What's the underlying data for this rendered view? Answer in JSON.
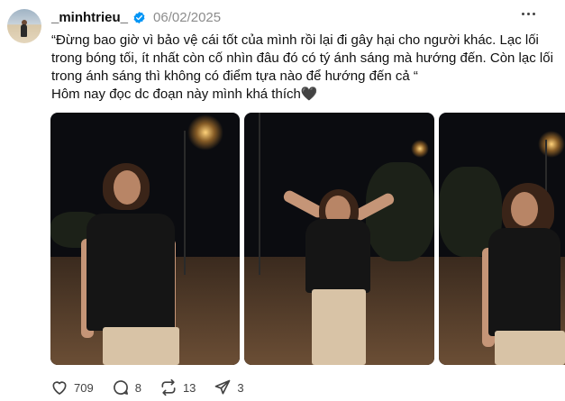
{
  "post": {
    "username": "_minhtrieu_",
    "date": "06/02/2025",
    "caption_line1": "“Đừng bao giờ vì bảo vệ cái tốt của mình rồi lại đi gây hại cho người khác. Lạc lối trong bóng tối, ít nhất còn cố nhìn đâu đó có tý ánh sáng mà hướng đến. Còn lạc lối trong ánh sáng thì không có điểm tựa nào để hướng đến cả “",
    "caption_line2": "Hôm nay đọc dc đoạn này mình khá thích🖤"
  },
  "actions": {
    "likes": "709",
    "comments": "8",
    "reposts": "13",
    "shares": "3"
  },
  "icons": [
    "verified-badge-icon",
    "more-dots-icon",
    "heart-icon",
    "comment-icon",
    "repost-icon",
    "share-icon"
  ],
  "colors": {
    "verified": "#0095f6",
    "secondary_text": "#8c8c8c",
    "text": "#101010"
  }
}
